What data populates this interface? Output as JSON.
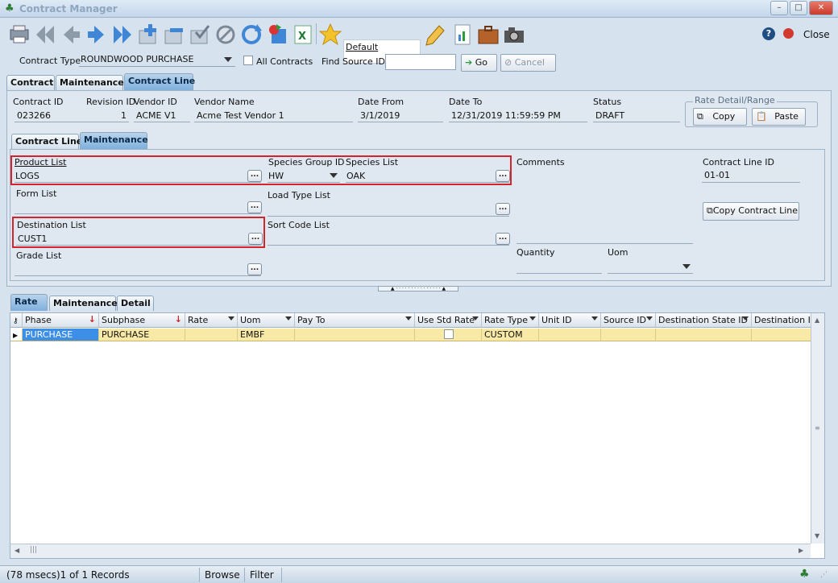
{
  "window": {
    "title": "Contract Manager"
  },
  "toolbar": {
    "layout_name": "Default",
    "close_label": "Close"
  },
  "filter": {
    "contract_type_label": "Contract Type",
    "contract_type_value": "ROUNDWOOD PURCHASE",
    "all_contracts_label": "All Contracts",
    "find_source_label": "Find Source ID:",
    "find_source_value": "",
    "go_label": "Go",
    "cancel_label": "Cancel"
  },
  "top_tabs": [
    "Contract",
    "Maintenance",
    "Contract Line"
  ],
  "header": {
    "fields": [
      {
        "label": "Contract ID",
        "value": "023266"
      },
      {
        "label": "Revision ID",
        "value": "1"
      },
      {
        "label": "Vendor ID",
        "value": "ACME V1"
      },
      {
        "label": "Vendor Name",
        "value": "Acme Test Vendor 1"
      },
      {
        "label": "Date From",
        "value": "3/1/2019"
      },
      {
        "label": "Date To",
        "value": "12/31/2019 11:59:59 PM"
      },
      {
        "label": "Status",
        "value": "DRAFT"
      }
    ],
    "rate_group_title": "Rate Detail/Range",
    "copy_label": "Copy",
    "paste_label": "Paste"
  },
  "sub_tabs": [
    "Contract Line",
    "Maintenance"
  ],
  "maint": {
    "product_list_label": "Product List",
    "product_list_value": "LOGS",
    "species_group_label": "Species Group ID",
    "species_group_value": "HW",
    "species_list_label": "Species List",
    "species_list_value": "OAK",
    "comments_label": "Comments",
    "contract_line_id_label": "Contract Line ID",
    "contract_line_id_value": "01-01",
    "form_list_label": "Form List",
    "form_list_value": "",
    "load_type_label": "Load Type List",
    "load_type_value": "",
    "copy_line_label": "Copy Contract Line",
    "destination_label": "Destination List",
    "destination_value": "CUST1",
    "sort_code_label": "Sort Code List",
    "sort_code_value": "",
    "grade_list_label": "Grade List",
    "grade_list_value": "",
    "quantity_label": "Quantity",
    "quantity_value": "",
    "uom_label": "Uom",
    "uom_value": "",
    "ellipsis": "..."
  },
  "grid_tabs": [
    "Rate",
    "Maintenance",
    "Detail"
  ],
  "grid": {
    "columns": [
      "Phase",
      "Subphase",
      "Rate",
      "Uom",
      "Pay To",
      "Use Std Rate",
      "Rate Type",
      "Unit ID",
      "Source ID",
      "Destination State ID",
      "Destination ID"
    ],
    "rows": [
      [
        "PURCHASE",
        "PURCHASE",
        "",
        "EMBF",
        "",
        "",
        "CUSTOM",
        "",
        "",
        "",
        ""
      ]
    ]
  },
  "status": {
    "records": "(78 msecs)1 of 1 Records",
    "mode1": "Browse",
    "mode2": "Filter"
  }
}
